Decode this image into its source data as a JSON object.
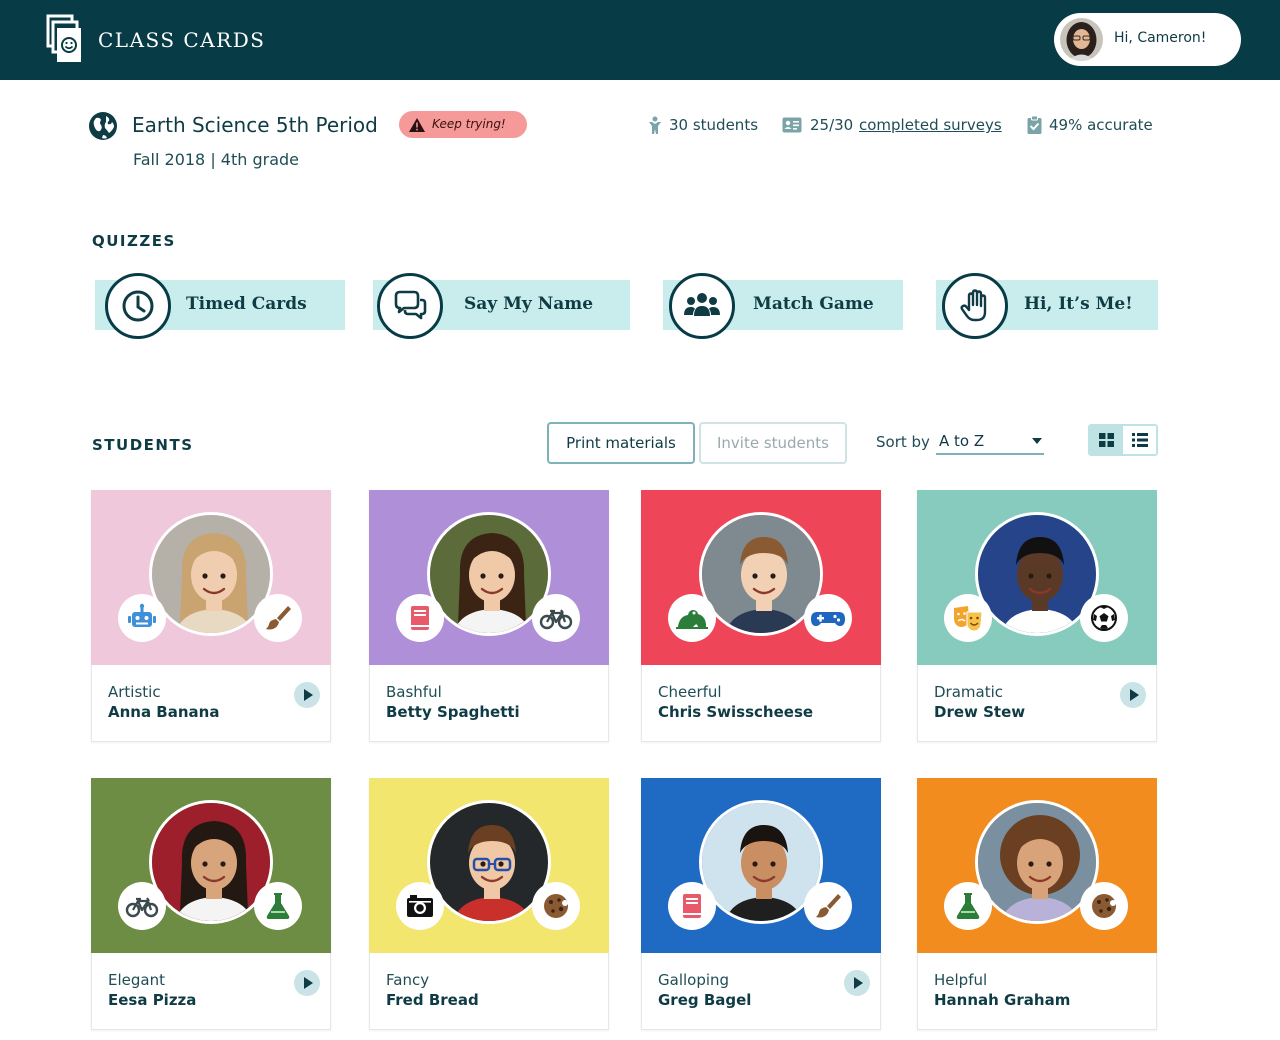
{
  "header": {
    "brand": "CLASS CARDS",
    "greeting": "Hi, Cameron!",
    "logo_icon": "smiley-cards-icon",
    "background_color": "#073b46"
  },
  "class_info": {
    "title": "Earth Science 5th Period",
    "badge": "Keep trying!",
    "subtitle": "Fall 2018 | 4th grade",
    "stats": {
      "students": "30 students",
      "surveys_count": "25/30",
      "surveys_link": "completed surveys",
      "accuracy": "49% accurate"
    }
  },
  "quizzes": {
    "label": "QUIZZES",
    "items": [
      {
        "label": "Timed Cards",
        "icon": "clock-icon"
      },
      {
        "label": "Say My Name",
        "icon": "speech-bubbles-icon"
      },
      {
        "label": "Match Game",
        "icon": "group-icon"
      },
      {
        "label": "Hi, It’s Me!",
        "icon": "raised-hand-icon"
      }
    ]
  },
  "students": {
    "label": "STUDENTS",
    "print_button": "Print materials",
    "invite_button": "Invite students",
    "sort_label": "Sort by",
    "sort_value": "A to Z",
    "items": [
      {
        "trait": "Artistic",
        "name": "Anna Banana",
        "color": "#f0c8dc",
        "left_icon": "robot-icon",
        "right_icon": "paintbrush-icon",
        "has_audio": true
      },
      {
        "trait": "Bashful",
        "name": "Betty Spaghetti",
        "color": "#b08fd9",
        "left_icon": "book-icon",
        "right_icon": "bicycle-icon",
        "has_audio": false
      },
      {
        "trait": "Cheerful",
        "name": "Chris Swisscheese",
        "color": "#ef4558",
        "left_icon": "frog-icon",
        "right_icon": "gamepad-icon",
        "has_audio": false
      },
      {
        "trait": "Dramatic",
        "name": "Drew Stew",
        "color": "#86cbbd",
        "left_icon": "theater-masks-icon",
        "right_icon": "soccer-ball-icon",
        "has_audio": true
      },
      {
        "trait": "Elegant",
        "name": "Eesa Pizza",
        "color": "#6d8c44",
        "left_icon": "bicycle-icon",
        "right_icon": "flask-icon",
        "has_audio": true
      },
      {
        "trait": "Fancy",
        "name": "Fred Bread",
        "color": "#f2e66f",
        "left_icon": "camera-icon",
        "right_icon": "cookie-icon",
        "has_audio": false
      },
      {
        "trait": "Galloping",
        "name": "Greg Bagel",
        "color": "#1f6bc3",
        "left_icon": "book-icon",
        "right_icon": "paintbrush-icon",
        "has_audio": true
      },
      {
        "trait": "Helpful",
        "name": "Hannah Graham",
        "color": "#f38c1f",
        "left_icon": "flask-icon",
        "right_icon": "cookie-icon",
        "has_audio": false
      }
    ]
  }
}
